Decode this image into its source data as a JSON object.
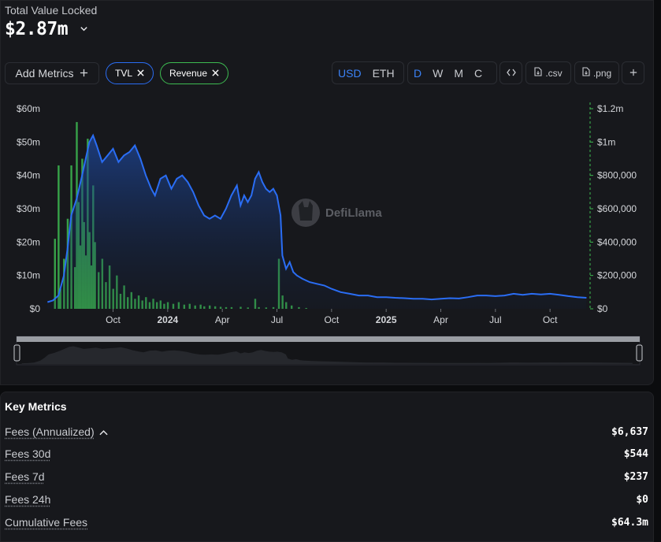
{
  "header": {
    "tvl_label": "Total Value Locked",
    "tvl_value": "$2.87m"
  },
  "toolbar": {
    "add_metrics": "Add Metrics",
    "pills": [
      {
        "label": "TVL",
        "color": "#2a6df4"
      },
      {
        "label": "Revenue",
        "color": "#3dbb51"
      }
    ],
    "currencies": [
      "USD",
      "ETH"
    ],
    "active_currency": "USD",
    "periods": [
      "D",
      "W",
      "M",
      "C"
    ],
    "active_period": "D",
    "embed_icon": "code-icon",
    "csv_label": ".csv",
    "png_label": ".png"
  },
  "chart_data": {
    "type": "area",
    "watermark": "DefiLlama",
    "left_axis": {
      "ticks": [
        "$0",
        "$10m",
        "$20m",
        "$30m",
        "$40m",
        "$50m",
        "$60m"
      ],
      "ylim": [
        0,
        60000000
      ]
    },
    "right_axis": {
      "ticks": [
        "$0",
        "$200,000",
        "$400,000",
        "$600,000",
        "$800,000",
        "$1m",
        "$1.2m"
      ],
      "ylim": [
        0,
        1200000
      ]
    },
    "x_ticks": [
      {
        "label": "Oct",
        "bold": false
      },
      {
        "label": "2024",
        "bold": true
      },
      {
        "label": "Apr",
        "bold": false
      },
      {
        "label": "Jul",
        "bold": false
      },
      {
        "label": "Oct",
        "bold": false
      },
      {
        "label": "2025",
        "bold": true
      },
      {
        "label": "Apr",
        "bold": false
      },
      {
        "label": "Jul",
        "bold": false
      },
      {
        "label": "Oct",
        "bold": false
      }
    ],
    "x_tick_months": [
      3,
      6,
      9,
      12,
      15,
      18,
      21,
      24,
      27
    ],
    "x_range_months": [
      -0.7,
      29.2
    ],
    "series": [
      {
        "name": "TVL",
        "axis": "left",
        "color": "#2a6df4",
        "points": [
          [
            -0.6,
            2
          ],
          [
            -0.3,
            2.5
          ],
          [
            0,
            4
          ],
          [
            0.3,
            10
          ],
          [
            0.5,
            18
          ],
          [
            0.7,
            28
          ],
          [
            1,
            33
          ],
          [
            1.3,
            40
          ],
          [
            1.5,
            45
          ],
          [
            1.7,
            50
          ],
          [
            1.9,
            52
          ],
          [
            2.1,
            49
          ],
          [
            2.4,
            44
          ],
          [
            2.7,
            46
          ],
          [
            3,
            48
          ],
          [
            3.3,
            44
          ],
          [
            3.6,
            46
          ],
          [
            3.9,
            47
          ],
          [
            4.2,
            49
          ],
          [
            4.5,
            45
          ],
          [
            4.8,
            40
          ],
          [
            5.1,
            36
          ],
          [
            5.3,
            34
          ],
          [
            5.6,
            39
          ],
          [
            5.9,
            40
          ],
          [
            6.2,
            36
          ],
          [
            6.5,
            39
          ],
          [
            6.8,
            40
          ],
          [
            7.1,
            38
          ],
          [
            7.4,
            35
          ],
          [
            7.7,
            31
          ],
          [
            8,
            28
          ],
          [
            8.3,
            27
          ],
          [
            8.6,
            28
          ],
          [
            8.9,
            27
          ],
          [
            9.2,
            30
          ],
          [
            9.5,
            34
          ],
          [
            9.8,
            37
          ],
          [
            10,
            31
          ],
          [
            10.2,
            34
          ],
          [
            10.4,
            32
          ],
          [
            10.6,
            34
          ],
          [
            10.8,
            39
          ],
          [
            11,
            41
          ],
          [
            11.2,
            38
          ],
          [
            11.4,
            36
          ],
          [
            11.6,
            35
          ],
          [
            11.8,
            36
          ],
          [
            12,
            34
          ],
          [
            12.2,
            28
          ],
          [
            12.3,
            16
          ],
          [
            12.5,
            12
          ],
          [
            12.7,
            14
          ],
          [
            12.9,
            11
          ],
          [
            13.1,
            10
          ],
          [
            13.4,
            9
          ],
          [
            13.8,
            8
          ],
          [
            14.2,
            7.5
          ],
          [
            14.6,
            7
          ],
          [
            15,
            6
          ],
          [
            15.5,
            5
          ],
          [
            16,
            4.5
          ],
          [
            16.5,
            4
          ],
          [
            17,
            4
          ],
          [
            17.5,
            3.5
          ],
          [
            18,
            3.5
          ],
          [
            18.5,
            3.3
          ],
          [
            19,
            3.2
          ],
          [
            19.5,
            3
          ],
          [
            20,
            3
          ],
          [
            20.5,
            2.8
          ],
          [
            21,
            3
          ],
          [
            21.5,
            3.2
          ],
          [
            22,
            3.1
          ],
          [
            22.5,
            3.5
          ],
          [
            23,
            4
          ],
          [
            23.5,
            4
          ],
          [
            24,
            3.8
          ],
          [
            24.5,
            4
          ],
          [
            25,
            4.5
          ],
          [
            25.5,
            4.2
          ],
          [
            26,
            4.5
          ],
          [
            26.5,
            4.3
          ],
          [
            27,
            4.5
          ],
          [
            27.5,
            4.2
          ],
          [
            28,
            3.8
          ],
          [
            28.5,
            3.5
          ],
          [
            29,
            3.3
          ]
        ]
      },
      {
        "name": "Revenue",
        "axis": "right",
        "color": "#3dbb51",
        "points": [
          [
            -0.2,
            420000
          ],
          [
            0,
            860000
          ],
          [
            0.1,
            120000
          ],
          [
            0.3,
            300000
          ],
          [
            0.5,
            540000
          ],
          [
            0.7,
            860000
          ],
          [
            0.9,
            250000
          ],
          [
            1,
            1120000
          ],
          [
            1.1,
            640000
          ],
          [
            1.2,
            380000
          ],
          [
            1.3,
            900000
          ],
          [
            1.4,
            520000
          ],
          [
            1.5,
            320000
          ],
          [
            1.6,
            1020000
          ],
          [
            1.7,
            460000
          ],
          [
            1.8,
            260000
          ],
          [
            1.9,
            740000
          ],
          [
            2,
            400000
          ],
          [
            2.2,
            220000
          ],
          [
            2.4,
            300000
          ],
          [
            2.6,
            160000
          ],
          [
            2.8,
            260000
          ],
          [
            3,
            120000
          ],
          [
            3.2,
            200000
          ],
          [
            3.4,
            90000
          ],
          [
            3.6,
            140000
          ],
          [
            3.8,
            70000
          ],
          [
            4,
            100000
          ],
          [
            4.2,
            60000
          ],
          [
            4.4,
            80000
          ],
          [
            4.6,
            50000
          ],
          [
            4.8,
            70000
          ],
          [
            5,
            40000
          ],
          [
            5.2,
            60000
          ],
          [
            5.4,
            40000
          ],
          [
            5.6,
            50000
          ],
          [
            5.8,
            30000
          ],
          [
            6,
            40000
          ],
          [
            6.3,
            30000
          ],
          [
            6.6,
            40000
          ],
          [
            6.9,
            25000
          ],
          [
            7.2,
            30000
          ],
          [
            7.5,
            20000
          ],
          [
            7.8,
            25000
          ],
          [
            8,
            15000
          ],
          [
            8.3,
            20000
          ],
          [
            8.6,
            15000
          ],
          [
            8.9,
            12000
          ],
          [
            9.2,
            10000
          ],
          [
            9.5,
            10000
          ],
          [
            10,
            12000
          ],
          [
            10.4,
            8000
          ],
          [
            10.8,
            60000
          ],
          [
            11,
            10000
          ],
          [
            11.4,
            8000
          ],
          [
            11.8,
            10000
          ],
          [
            12.1,
            300000
          ],
          [
            12.3,
            80000
          ],
          [
            12.5,
            40000
          ],
          [
            12.8,
            20000
          ],
          [
            13.2,
            10000
          ],
          [
            13.6,
            5000
          ]
        ]
      }
    ],
    "legend": "none",
    "grid": false
  },
  "key_metrics": {
    "title": "Key Metrics",
    "rows": [
      {
        "label": "Fees (Annualized)",
        "value": "$6,637",
        "expanded": true
      },
      {
        "label": "Fees 30d",
        "value": "$544"
      },
      {
        "label": "Fees 7d",
        "value": "$237"
      },
      {
        "label": "Fees 24h",
        "value": "$0"
      },
      {
        "label": "Cumulative Fees",
        "value": "$64.3m"
      }
    ]
  }
}
